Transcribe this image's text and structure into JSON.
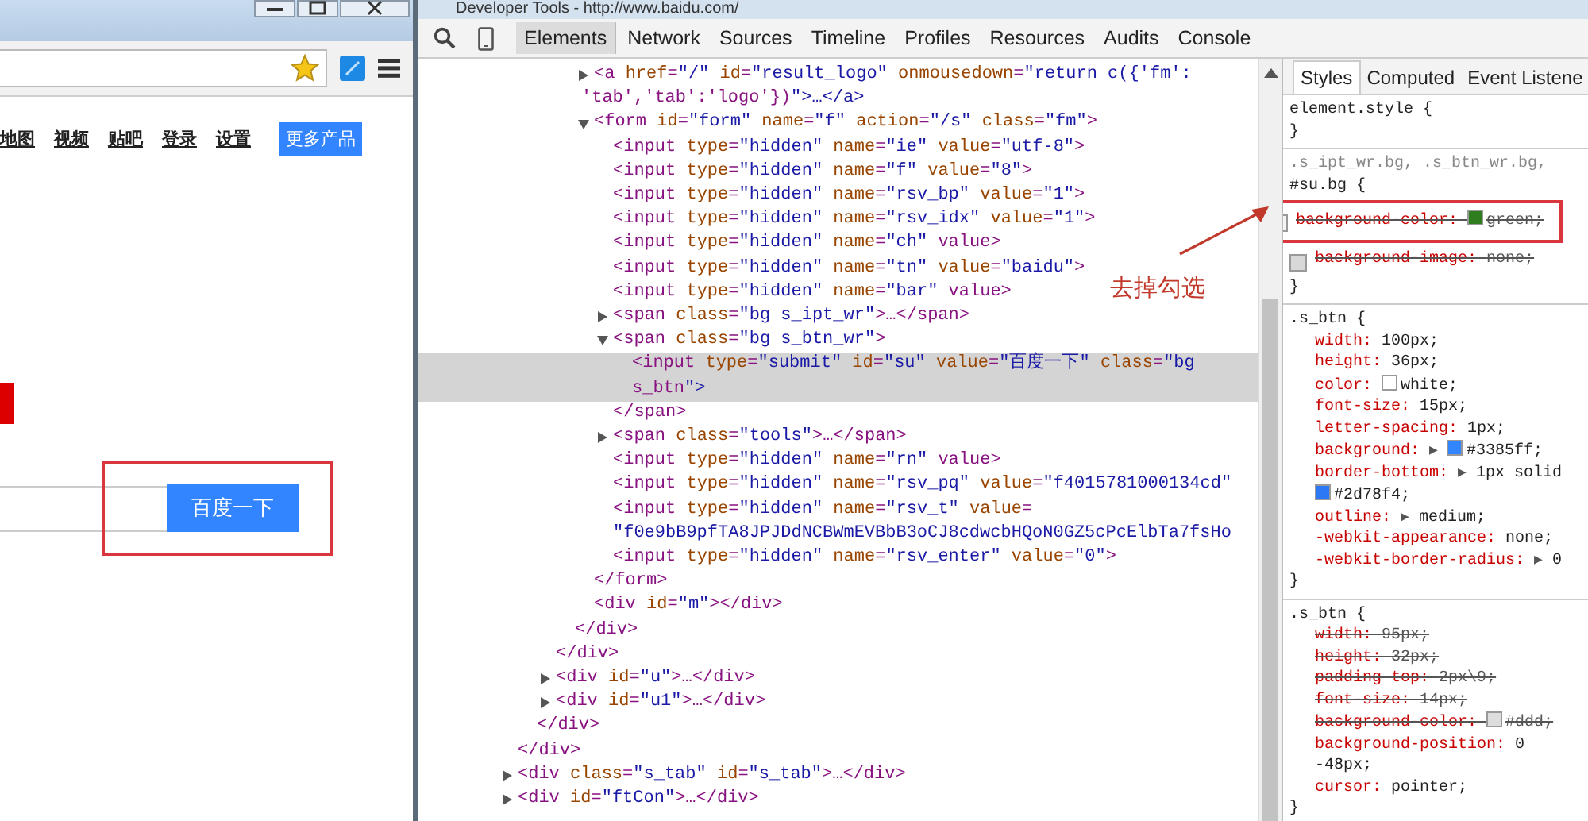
{
  "browser": {
    "nav_links": [
      "地图",
      "视频",
      "贴吧",
      "登录",
      "设置"
    ],
    "more_button": "更多产品",
    "search_button": "百度一下"
  },
  "devtools": {
    "title": "Developer Tools - http://www.baidu.com/",
    "tabs": [
      {
        "label": "Elements",
        "selected": true
      },
      {
        "label": "Network",
        "selected": false
      },
      {
        "label": "Sources",
        "selected": false
      },
      {
        "label": "Timeline",
        "selected": false
      },
      {
        "label": "Profiles",
        "selected": false
      },
      {
        "label": "Resources",
        "selected": false
      },
      {
        "label": "Audits",
        "selected": false
      },
      {
        "label": "Console",
        "selected": false
      }
    ],
    "dom_tree": [
      {
        "children": [
          {
            "children": [
              {
                "children": [
                  {
                    "children": [
                      {
                        "lines": [
                          "<a href=\"/\" id=\"result_logo\" onmousedown=\"return c({'fm':",
                          "'tab','tab':'logo'})\">…</a>"
                        ],
                        "expanded": false,
                        "selected": false
                      },
                      {
                        "lines": [
                          "<form id=\"form\" name=\"f\" action=\"/s\" class=\"fm\">"
                        ],
                        "expanded": true,
                        "selected": false,
                        "children": [
                          {
                            "lines": [
                              "<input type=\"hidden\" name=\"ie\" value=\"utf-8\">"
                            ],
                            "selected": false
                          },
                          {
                            "lines": [
                              "<input type=\"hidden\" name=\"f\" value=\"8\">"
                            ],
                            "selected": false
                          },
                          {
                            "lines": [
                              "<input type=\"hidden\" name=\"rsv_bp\" value=\"1\">"
                            ],
                            "selected": false
                          },
                          {
                            "lines": [
                              "<input type=\"hidden\" name=\"rsv_idx\" value=\"1\">"
                            ],
                            "selected": false
                          },
                          {
                            "lines": [
                              "<input type=\"hidden\" name=\"ch\" value>"
                            ],
                            "selected": false
                          },
                          {
                            "lines": [
                              "<input type=\"hidden\" name=\"tn\" value=\"baidu\">"
                            ],
                            "selected": false
                          },
                          {
                            "lines": [
                              "<input type=\"hidden\" name=\"bar\" value>"
                            ],
                            "selected": false
                          },
                          {
                            "lines": [
                              "<span class=\"bg s_ipt_wr\">…</span>"
                            ],
                            "expanded": false,
                            "selected": false
                          },
                          {
                            "lines": [
                              "<span class=\"bg s_btn_wr\">"
                            ],
                            "expanded": true,
                            "selected": false,
                            "children": [
                              {
                                "lines": [
                                  "<input type=\"submit\" id=\"su\" value=\"百度一下\" class=\"bg",
                                  "s_btn\">"
                                ],
                                "selected": true
                              }
                            ]
                          },
                          {
                            "lines": [
                              "</span>"
                            ],
                            "selected": false
                          },
                          {
                            "lines": [
                              "<span class=\"tools\">…</span>"
                            ],
                            "expanded": false,
                            "selected": false
                          },
                          {
                            "lines": [
                              "<input type=\"hidden\" name=\"rn\" value>"
                            ],
                            "selected": false
                          },
                          {
                            "lines": [
                              "<input type=\"hidden\" name=\"rsv_pq\" value=\"f4015781000134cd\""
                            ],
                            "selected": false
                          },
                          {
                            "lines": [
                              "<input type=\"hidden\" name=\"rsv_t\" value=",
                              "\"f0e9bB9pfTA8JPJDdNCBWmEVBbB3oCJ8cdwcbHQoN0GZ5cPcElbTa7fsHo"
                            ],
                            "selected": false
                          },
                          {
                            "lines": [
                              "<input type=\"hidden\" name=\"rsv_enter\" value=\"0\">"
                            ],
                            "selected": false
                          }
                        ]
                      },
                      {
                        "lines": [
                          "</form>"
                        ],
                        "selected": false
                      },
                      {
                        "lines": [
                          "<div id=\"m\"></div>"
                        ],
                        "selected": false
                      }
                    ]
                  },
                  {
                    "lines": [
                      "</div>"
                    ],
                    "selected": false
                  }
                ]
              },
              {
                "lines": [
                  "</div>"
                ],
                "selected": false
              },
              {
                "lines": [
                  "<div id=\"u\">…</div>"
                ],
                "expanded": false,
                "selected": false
              },
              {
                "lines": [
                  "<div id=\"u1\">…</div>"
                ],
                "expanded": false,
                "selected": false
              }
            ]
          },
          {
            "lines": [
              "</div>"
            ],
            "selected": false
          }
        ]
      },
      {
        "lines": [
          "</div>"
        ],
        "selected": false
      },
      {
        "lines": [
          "<div class=\"s_tab\" id=\"s_tab\">…</div>"
        ],
        "expanded": false,
        "selected": false
      },
      {
        "lines": [
          "<div id=\"ftCon\">…</div>"
        ],
        "expanded": false,
        "selected": false
      }
    ],
    "styles_tabs": [
      {
        "label": "Styles",
        "selected": true
      },
      {
        "label": "Computed",
        "selected": false
      },
      {
        "label": "Event Listene",
        "selected": false
      }
    ],
    "rules": [
      {
        "selector_lines": [
          "element.style {"
        ],
        "close": "}"
      },
      {
        "selector_lines": [
          ".s_ipt_wr.bg, .s_btn_wr.bg,",
          "#su.bg {"
        ],
        "props": [
          {
            "name": "background-color:",
            "color": "#2e7d1e",
            "value": "green;",
            "overridden": true,
            "checked": false,
            "highlighted": true
          },
          {
            "name": "background-image:",
            "value": "none;",
            "overridden": true,
            "checked": true
          }
        ],
        "close": "}"
      },
      {
        "selector_lines": [
          ".s_btn {"
        ],
        "props": [
          {
            "name": "width:",
            "value": "100px;",
            "overridden": false
          },
          {
            "name": "height:",
            "value": "36px;",
            "overridden": false
          },
          {
            "name": "color:",
            "color": "#ffffff",
            "value": "white;",
            "overridden": false
          },
          {
            "name": "font-size:",
            "value": "15px;",
            "overridden": false
          },
          {
            "name": "letter-spacing:",
            "value": "1px;",
            "overridden": false
          },
          {
            "name": "background:",
            "expander": "▶",
            "color": "#3385ff",
            "value": "#3385ff;",
            "overridden": false
          },
          {
            "name": "border-bottom:",
            "expander": "▶",
            "pre": "1px solid",
            "color": "#2d78f4",
            "value": "#2d78f4;",
            "overridden": false
          },
          {
            "name": "outline:",
            "expander": "▶",
            "value": "medium;",
            "overridden": false
          },
          {
            "name": "-webkit-appearance:",
            "value": "none;",
            "overridden": false
          },
          {
            "name": "-webkit-border-radius:",
            "expander": "▶",
            "value": "0",
            "overridden": false
          }
        ],
        "close": "}"
      },
      {
        "selector_lines": [
          ".s_btn {"
        ],
        "props": [
          {
            "name": "width:",
            "value": "95px;",
            "overridden": true
          },
          {
            "name": "height:",
            "value": "32px;",
            "overridden": true
          },
          {
            "name": "padding-top:",
            "value": "2px\\9;",
            "overridden": true
          },
          {
            "name": "font-size:",
            "value": "14px;",
            "overridden": true
          },
          {
            "name": "background-color:",
            "color": "#dddddd",
            "value": "#ddd;",
            "overridden": true
          },
          {
            "name": "background-position:",
            "value": "0 -48px;",
            "overridden": false
          },
          {
            "name": "cursor:",
            "value": "pointer;",
            "overridden": false
          }
        ],
        "close": "}"
      }
    ]
  },
  "annotation": {
    "text": "去掉勾选"
  }
}
